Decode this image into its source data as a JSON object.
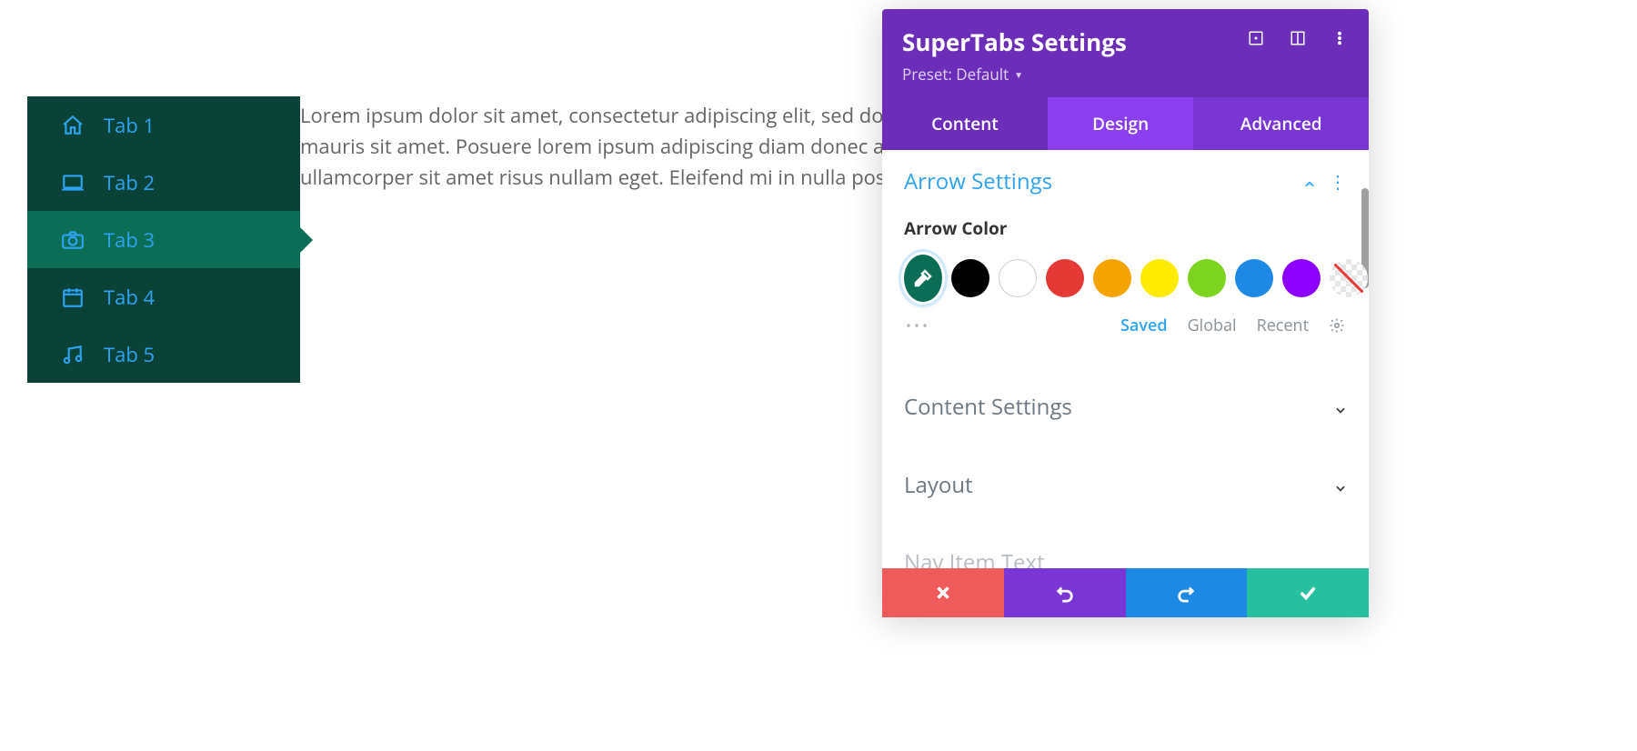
{
  "preview": {
    "tabs": [
      {
        "label": "Tab 1",
        "icon": "home"
      },
      {
        "label": "Tab 2",
        "icon": "laptop"
      },
      {
        "label": "Tab 3",
        "icon": "camera"
      },
      {
        "label": "Tab 4",
        "icon": "calendar"
      },
      {
        "label": "Tab 5",
        "icon": "music"
      }
    ],
    "active_index": 2,
    "content_text": "Lorem ipsum dolor sit amet, consectetur adipiscing elit, sed do eiusmod orci sagittis eu volutpat odio facilisis mauris sit amet. Posuere lorem ipsum adipiscing diam donec adipiscing tristique risus nec feugiat. Nisl pretium ullamcorper sit amet risus nullam eget. Eleifend mi in nulla posuere.",
    "trailing_char": "a"
  },
  "panel": {
    "title": "SuperTabs Settings",
    "preset_label": "Preset: Default",
    "header_icons": [
      "responsive-icon",
      "layout-icon",
      "more-icon"
    ],
    "tabs": {
      "content": "Content",
      "design": "Design",
      "advanced": "Advanced",
      "active": "design"
    },
    "sections": {
      "arrow": {
        "title": "Arrow Settings",
        "open": true,
        "field_label": "Arrow Color",
        "swatches": [
          {
            "name": "eyedropper-selected",
            "color": "#0b6d55",
            "selected": true
          },
          {
            "name": "black",
            "color": "#000000"
          },
          {
            "name": "white",
            "color": "#ffffff"
          },
          {
            "name": "red",
            "color": "#e53935"
          },
          {
            "name": "orange",
            "color": "#f5a300"
          },
          {
            "name": "yellow",
            "color": "#ffeb00"
          },
          {
            "name": "green",
            "color": "#7cd41e"
          },
          {
            "name": "blue",
            "color": "#1e88e5"
          },
          {
            "name": "purple",
            "color": "#8b00ff"
          },
          {
            "name": "transparent",
            "color": "transparent"
          }
        ],
        "palette_tabs": {
          "saved": "Saved",
          "global": "Global",
          "recent": "Recent"
        }
      },
      "content_settings": {
        "title": "Content Settings"
      },
      "layout": {
        "title": "Layout"
      },
      "nav_item_text": {
        "title": "Nav Item Text"
      }
    },
    "footer": [
      "cancel",
      "undo",
      "redo",
      "save"
    ]
  },
  "colors": {
    "tab_bg": "#0a4238",
    "tab_active_bg": "#0b6d55",
    "tab_text": "#2ea3f2",
    "panel_header": "#6c2eb9",
    "panel_tab_active": "#8b3ff0"
  }
}
